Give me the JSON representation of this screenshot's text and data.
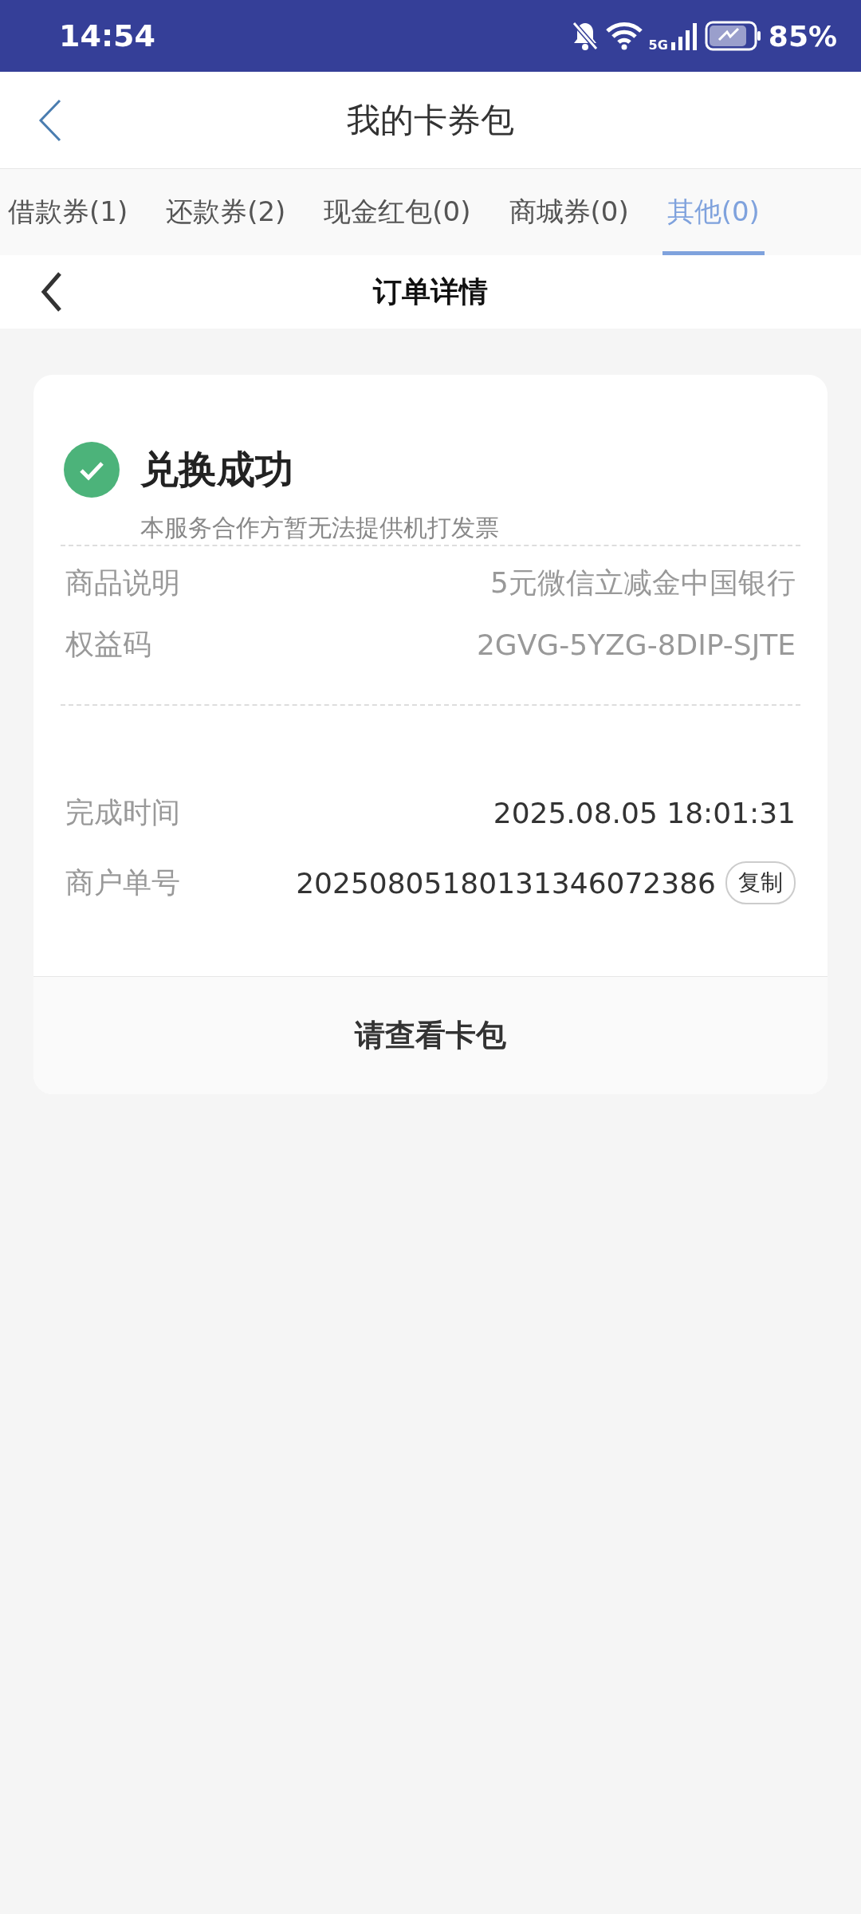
{
  "status_bar": {
    "time": "14:54",
    "network": "5G",
    "battery": "85%"
  },
  "header": {
    "title": "我的卡券包"
  },
  "tabs": [
    {
      "label": "借款券(1)",
      "selected": false
    },
    {
      "label": "还款券(2)",
      "selected": false
    },
    {
      "label": "现金红包(0)",
      "selected": false
    },
    {
      "label": "商城券(0)",
      "selected": false
    },
    {
      "label": "其他(0)",
      "selected": true
    }
  ],
  "subheader": {
    "title": "订单详情"
  },
  "result": {
    "title": "兑换成功",
    "note": "本服务合作方暂无法提供机打发票"
  },
  "info_rows": [
    {
      "label": "商品说明",
      "value": "5元微信立减金中国银行"
    },
    {
      "label": "权益码",
      "value": "2GVG-5YZG-8DIP-SJTE"
    }
  ],
  "order_rows": [
    {
      "label": "完成时间",
      "value": "2025.08.05 18:01:31"
    },
    {
      "label": "商户单号",
      "value": "20250805180131346072386",
      "action": "复制"
    }
  ],
  "footer_button": "请查看卡包"
}
